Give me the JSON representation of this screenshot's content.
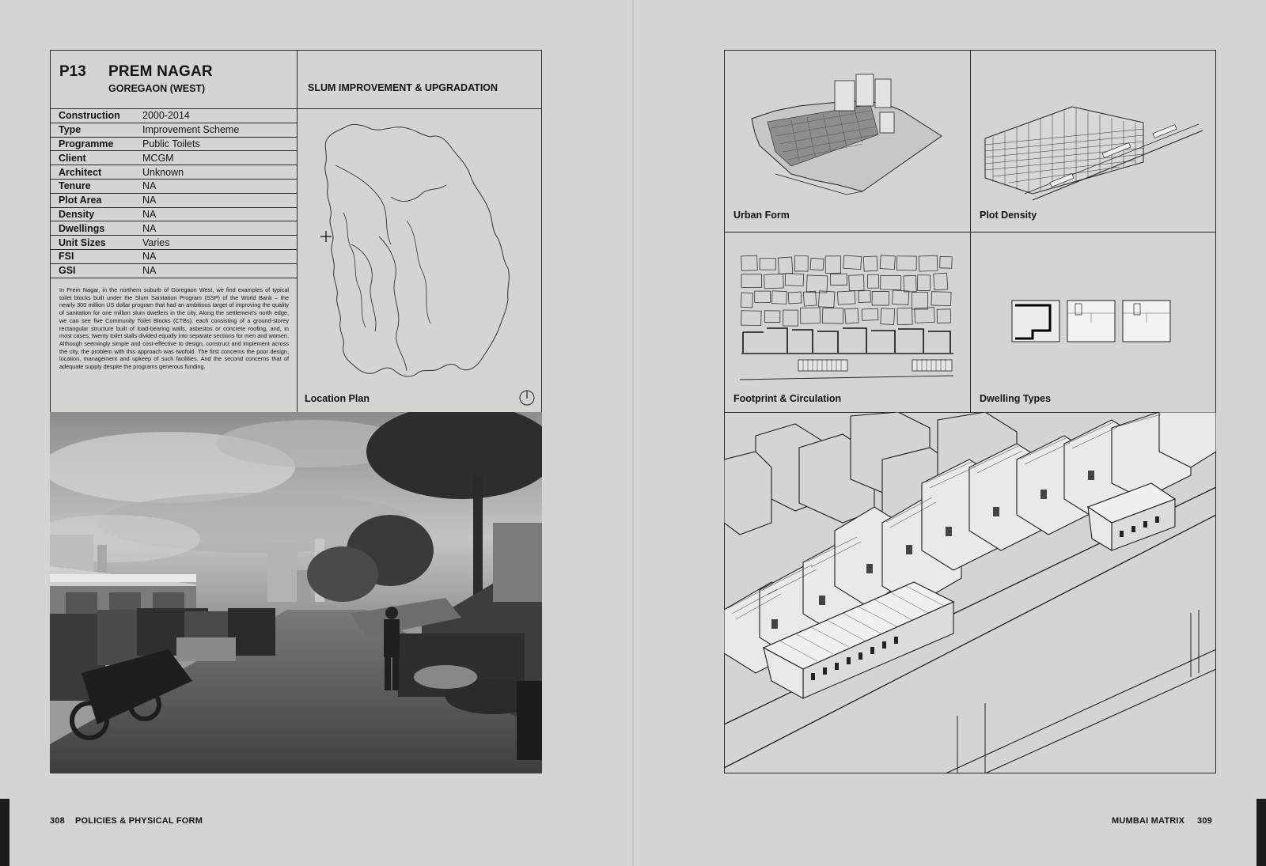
{
  "project": {
    "code": "P13",
    "name": "PREM NAGAR",
    "location": "GOREGAON (WEST)",
    "category": "SLUM IMPROVEMENT & UPGRADATION"
  },
  "specs": [
    {
      "key": "Construction",
      "value": "2000-2014"
    },
    {
      "key": "Type",
      "value": "Improvement Scheme"
    },
    {
      "key": "Programme",
      "value": "Public Toilets"
    },
    {
      "key": "Client",
      "value": "MCGM"
    },
    {
      "key": "Architect",
      "value": "Unknown"
    },
    {
      "key": "Tenure",
      "value": "NA"
    },
    {
      "key": "Plot Area",
      "value": "NA"
    },
    {
      "key": "Density",
      "value": "NA"
    },
    {
      "key": "Dwellings",
      "value": "NA"
    },
    {
      "key": "Unit Sizes",
      "value": "Varies"
    },
    {
      "key": "FSI",
      "value": "NA"
    },
    {
      "key": "GSI",
      "value": "NA"
    }
  ],
  "description": "In Prem Nagar, in the northern suburb of Goregaon West, we find examples of typical toilet blocks built under the Slum Sanitation Program (SSP) of the World Bank – the nearly 300 million US dollar program that had an ambitious target of improving the quality of sanitation for one million slum dwellers in the city. Along the settlement's north edge, we can see five Community Toilet Blocks (CTBs), each consisting of a ground-storey rectangular structure built of load-bearing walls, asbestos or concrete roofing, and, in most cases, twenty toilet stalls divided equally into separate sections for men and women. Although seemingly simple and cost-effective to design, construct and implement across the city, the problem with this approach was twofold. The first concerns the poor design, location, management and upkeep of such facilities. And the second concerns that of adequate supply despite the programs generous funding.",
  "panels": {
    "location_plan": "Location Plan",
    "urban_form": "Urban Form",
    "plot_density": "Plot Density",
    "footprint": "Footprint & Circulation",
    "dwelling_types": "Dwelling Types"
  },
  "folio": {
    "left_number": "308",
    "left_section": "POLICIES & PHYSICAL FORM",
    "right_section": "MUMBAI MATRIX",
    "right_number": "309"
  }
}
